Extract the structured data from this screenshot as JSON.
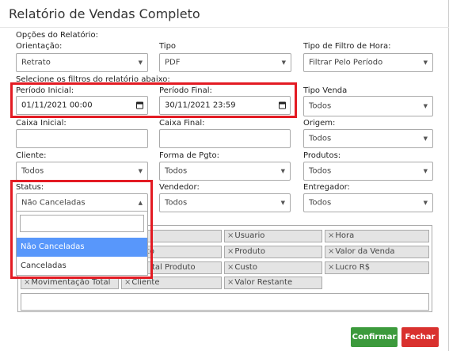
{
  "title": "Relatório de Vendas Completo",
  "sections": {
    "options_header": "Opções do Relatório:",
    "filters_header": "Selecione os filtros do relatório abaixo:"
  },
  "fields": {
    "orientacao": {
      "label": "Orientação:",
      "value": "Retrato"
    },
    "tipo": {
      "label": "Tipo",
      "value": "PDF"
    },
    "tipo_filtro_hora": {
      "label": "Tipo de Filtro de Hora:",
      "value": "Filtrar Pelo Período"
    },
    "periodo_inicial": {
      "label": "Período Inicial:",
      "value": "01/11/2021 00:00"
    },
    "periodo_final": {
      "label": "Período Final:",
      "value": "30/11/2021 23:59"
    },
    "tipo_venda": {
      "label": "Tipo Venda",
      "value": "Todos"
    },
    "caixa_inicial": {
      "label": "Caixa Inicial:",
      "value": ""
    },
    "caixa_final": {
      "label": "Caixa Final:",
      "value": ""
    },
    "origem": {
      "label": "Origem:",
      "value": "Todos"
    },
    "cliente": {
      "label": "Cliente:",
      "value": "Todos"
    },
    "forma_pgto": {
      "label": "Forma de Pgto:",
      "value": "Todos"
    },
    "produtos": {
      "label": "Produtos:",
      "value": "Todos"
    },
    "status": {
      "label": "Status:",
      "value": "Não Canceladas"
    },
    "vendedor": {
      "label": "Vendedor:",
      "value": "Todos"
    },
    "entregador": {
      "label": "Entregador:",
      "value": "Todos"
    }
  },
  "status_dropdown": {
    "options": [
      "Não Canceladas",
      "Canceladas"
    ],
    "highlighted": "Não Canceladas"
  },
  "columns_tags": [
    {
      "label": ""
    },
    {
      "label": "Usuario"
    },
    {
      "label": "Hora"
    },
    {
      "label": "to"
    },
    {
      "label": "Produto"
    },
    {
      "label": "Valor da Venda"
    },
    {
      "label": "tal Produto"
    },
    {
      "label": "Custo"
    },
    {
      "label": "Lucro R$"
    },
    {
      "label": "Movimentação Total"
    },
    {
      "label": "Cliente"
    },
    {
      "label": "Valor Restante"
    }
  ],
  "tag_remove_glyph": "×",
  "buttons": {
    "confirm": {
      "label": "Confirmar",
      "color": "#3c9a3c"
    },
    "close": {
      "label": "Fechar",
      "color": "#d9312e"
    }
  },
  "highlight_color": "#e31b23"
}
